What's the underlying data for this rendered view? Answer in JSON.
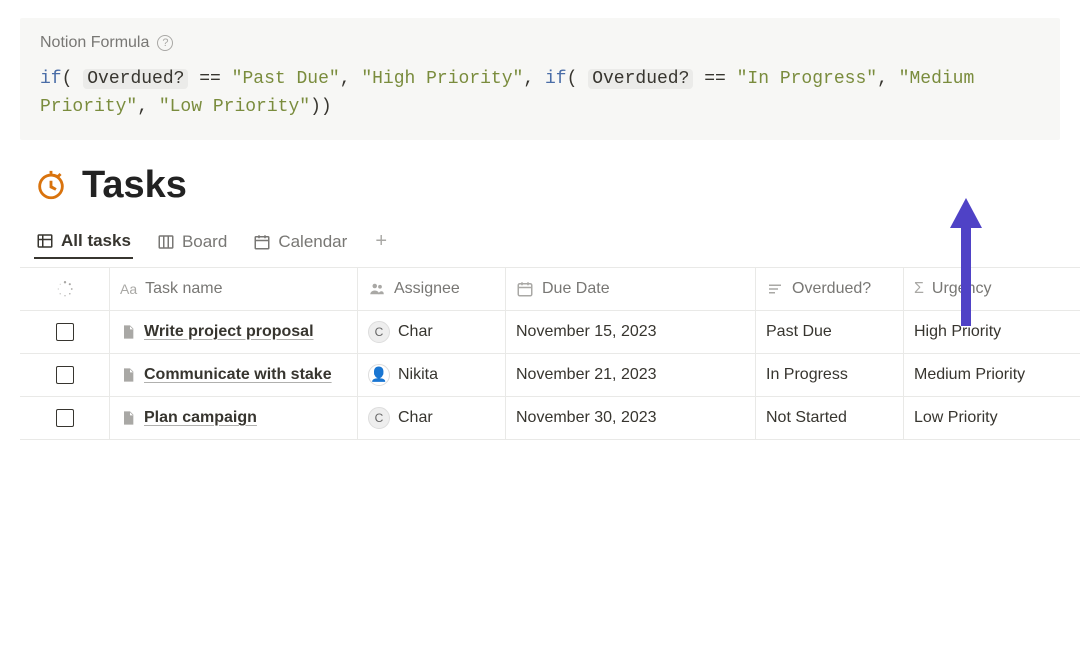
{
  "formula": {
    "header": "Notion Formula",
    "tokens": [
      {
        "t": "kw",
        "v": "if"
      },
      {
        "t": "punc",
        "v": "("
      },
      {
        "t": "op",
        "v": " "
      },
      {
        "t": "prop",
        "v": "Overdued?"
      },
      {
        "t": "op",
        "v": " == "
      },
      {
        "t": "str",
        "v": "\"Past Due\""
      },
      {
        "t": "punc",
        "v": ", "
      },
      {
        "t": "str",
        "v": "\"High Priority\""
      },
      {
        "t": "punc",
        "v": ", "
      },
      {
        "t": "kw",
        "v": "if"
      },
      {
        "t": "punc",
        "v": "("
      },
      {
        "t": "op",
        "v": " "
      },
      {
        "t": "prop",
        "v": "Overdued?"
      },
      {
        "t": "op",
        "v": " == "
      },
      {
        "t": "str",
        "v": "\"In Progress\""
      },
      {
        "t": "punc",
        "v": ", "
      },
      {
        "t": "str",
        "v": "\"Medium Priority\""
      },
      {
        "t": "punc",
        "v": ", "
      },
      {
        "t": "str",
        "v": "\"Low Priority\""
      },
      {
        "t": "punc",
        "v": "))"
      }
    ]
  },
  "page": {
    "title": "Tasks"
  },
  "tabs": [
    {
      "label": "All tasks",
      "active": true,
      "icon": "table"
    },
    {
      "label": "Board",
      "active": false,
      "icon": "board"
    },
    {
      "label": "Calendar",
      "active": false,
      "icon": "calendar"
    }
  ],
  "columns": [
    {
      "label": "",
      "icon": "spinner"
    },
    {
      "label": "Task name",
      "icon": "text"
    },
    {
      "label": "Assignee",
      "icon": "people"
    },
    {
      "label": "Due Date",
      "icon": "date"
    },
    {
      "label": "Overdued?",
      "icon": "lines"
    },
    {
      "label": "Urgency",
      "icon": "sigma"
    }
  ],
  "rows": [
    {
      "task": "Write project proposal",
      "assignee": {
        "name": "Char",
        "avatar": "letter",
        "initial": "C"
      },
      "due": "November 15, 2023",
      "overdued": "Past Due",
      "urgency": "High Priority"
    },
    {
      "task": "Communicate with stake",
      "assignee": {
        "name": "Nikita",
        "avatar": "face",
        "initial": "👤"
      },
      "due": "November 21, 2023",
      "overdued": "In Progress",
      "urgency": "Medium Priority"
    },
    {
      "task": "Plan campaign",
      "assignee": {
        "name": "Char",
        "avatar": "letter",
        "initial": "C"
      },
      "due": "November 30, 2023",
      "overdued": "Not Started",
      "urgency": "Low Priority"
    }
  ],
  "arrow_color": "#4f42c6"
}
